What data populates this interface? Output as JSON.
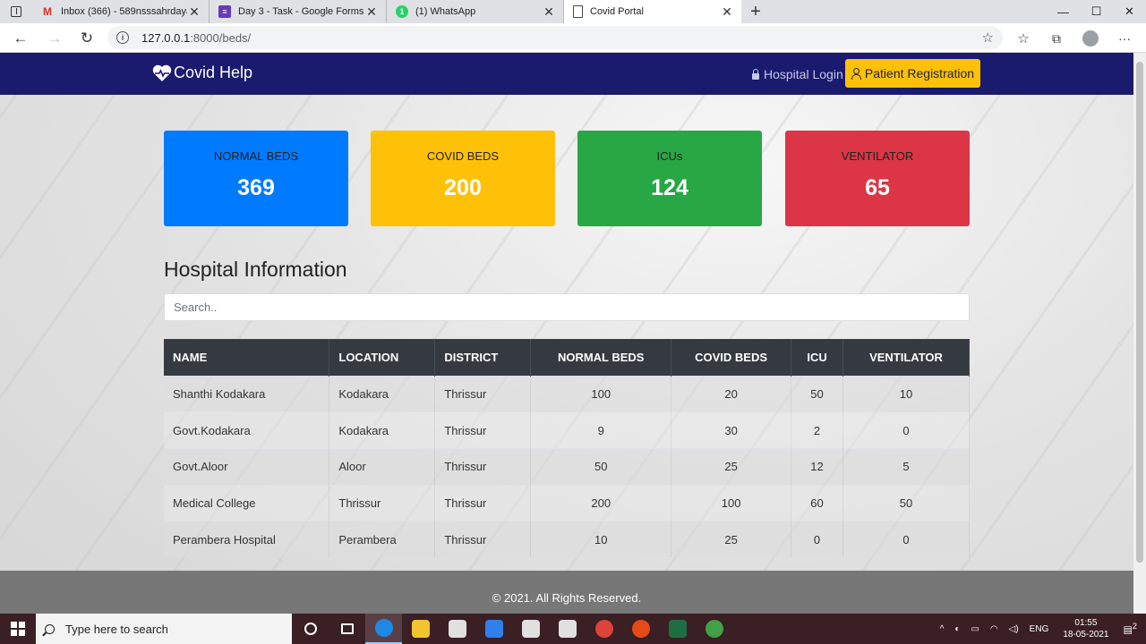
{
  "browser": {
    "tabs": [
      {
        "title": "Inbox (366) - 589nsssahrdaya@s",
        "icon": "gmail-icon",
        "color": "#d93025",
        "glyph": "M"
      },
      {
        "title": "Day 3 - Task - Google Forms",
        "icon": "forms-icon",
        "color": "#673ab7",
        "glyph": "≡"
      },
      {
        "title": "(1) WhatsApp",
        "icon": "whatsapp-icon",
        "color": "#25d366",
        "glyph": "1"
      },
      {
        "title": "Covid Portal",
        "icon": "page-icon",
        "color": "#ffffff",
        "glyph": ""
      }
    ],
    "url_host": "127.0.0.1",
    "url_rest": ":8000/beds/"
  },
  "navbar": {
    "brand": "Covid Help",
    "login_label": "Hospital Login",
    "register_label": "Patient Registration"
  },
  "stats": [
    {
      "label": "NORMAL BEDS",
      "value": "369",
      "color": "#007bff"
    },
    {
      "label": "COVID BEDS",
      "value": "200",
      "color": "#ffc107"
    },
    {
      "label": "ICUs",
      "value": "124",
      "color": "#28a745"
    },
    {
      "label": "VENTILATOR",
      "value": "65",
      "color": "#dc3545"
    }
  ],
  "section_title": "Hospital Information",
  "search": {
    "placeholder": "Search.."
  },
  "table": {
    "headers": [
      "NAME",
      "LOCATION",
      "DISTRICT",
      "NORMAL BEDS",
      "COVID BEDS",
      "ICU",
      "VENTILATOR"
    ],
    "rows": [
      [
        "Shanthi Kodakara",
        "Kodakara",
        "Thrissur",
        "100",
        "20",
        "50",
        "10"
      ],
      [
        "Govt.Kodakara",
        "Kodakara",
        "Thrissur",
        "9",
        "30",
        "2",
        "0"
      ],
      [
        "Govt.Aloor",
        "Aloor",
        "Thrissur",
        "50",
        "25",
        "12",
        "5"
      ],
      [
        "Medical College",
        "Thrissur",
        "Thrissur",
        "200",
        "100",
        "60",
        "50"
      ],
      [
        "Perambera Hospital",
        "Perambera",
        "Thrissur",
        "10",
        "25",
        "0",
        "0"
      ]
    ]
  },
  "footer": "© 2021. All Rights Reserved.",
  "taskbar": {
    "search_placeholder": "Type here to search",
    "apps": [
      {
        "name": "cortana-icon",
        "color": "none"
      },
      {
        "name": "task-view-icon",
        "color": "none"
      },
      {
        "name": "edge-icon",
        "color": "#1e88e5"
      },
      {
        "name": "file-explorer-icon",
        "color": "#f4c430"
      },
      {
        "name": "store-icon",
        "color": "#e0e0e0"
      },
      {
        "name": "mail-icon",
        "color": "#2f80ed"
      },
      {
        "name": "dropbox-icon",
        "color": "#e0e0e0"
      },
      {
        "name": "bolt-app-icon",
        "color": "#e0e0e0"
      },
      {
        "name": "chrome-icon",
        "color": "#db4437"
      },
      {
        "name": "camera-app-icon",
        "color": "#e64a19"
      },
      {
        "name": "excel-icon",
        "color": "#1d6f42"
      },
      {
        "name": "green-app-icon",
        "color": "#43a047"
      }
    ],
    "lang": "ENG",
    "time": "01:55",
    "date": "18-05-2021",
    "notifications": "2"
  }
}
